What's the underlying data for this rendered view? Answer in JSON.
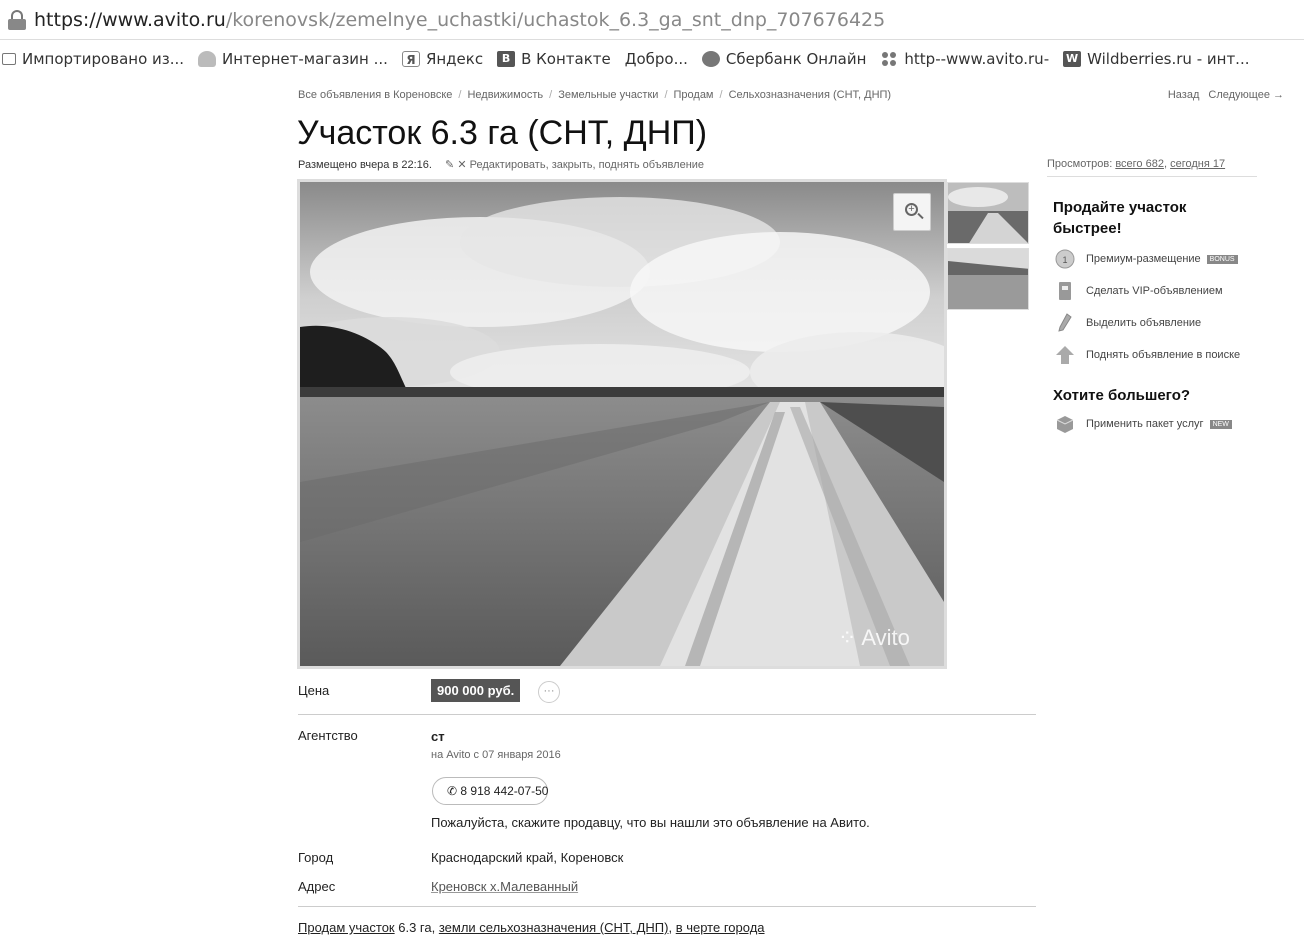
{
  "browser": {
    "url_host": "https://www.avito.ru",
    "url_path": "/korenovsk/zemelnye_uchastki/uchastok_6.3_ga_snt_dnp_707676425",
    "bookmarks": [
      {
        "label": "Импортировано из...",
        "icon": "folder-icon"
      },
      {
        "label": "Интернет-магазин ...",
        "icon": "shop-icon"
      },
      {
        "label": "Яндекс",
        "icon": "yandex-icon",
        "glyph": "Я"
      },
      {
        "label": "В Контакте",
        "icon": "vk-icon",
        "glyph": "B"
      },
      {
        "label": "Добро...",
        "icon": null
      },
      {
        "label": "Сбербанк Онлайн",
        "icon": "sberbank-icon"
      },
      {
        "label": "http--www.avito.ru-",
        "icon": "avito-icon"
      },
      {
        "label": "Wildberries.ru - инт...",
        "icon": "wildberries-icon",
        "glyph": "W"
      }
    ]
  },
  "breadcrumbs": [
    "Все объявления в Кореновске",
    "Недвижимость",
    "Земельные участки",
    "Продам",
    "Сельхозназначения (СНТ, ДНП)"
  ],
  "nav": {
    "back": "Назад",
    "next": "Следующее →"
  },
  "listing": {
    "title": "Участок 6.3 га (СНТ, ДНП)",
    "posted": "Размещено вчера в 22:16.",
    "edit_link": "Редактировать, закрыть, поднять объявление",
    "views_prefix": "Просмотров: ",
    "views_total": "всего 682",
    "views_today": "сегодня 17",
    "watermark": "Avito"
  },
  "sidebar": {
    "heading": "Продайте участок быстрее!",
    "items": [
      {
        "label": "Премиум-размещение",
        "badge": "BONUS"
      },
      {
        "label": "Сделать VIP-объявлением",
        "badge": ""
      },
      {
        "label": "Выделить объявление",
        "badge": ""
      },
      {
        "label": "Поднять объявление в поиске",
        "badge": ""
      }
    ],
    "heading2": "Хотите большего?",
    "package": {
      "label": "Применить пакет услуг",
      "badge": "NEW"
    }
  },
  "details": {
    "price_label": "Цена",
    "price": "900 000 руб.",
    "more": "···",
    "agency_label": "Агентство",
    "agency_name": "ст",
    "agency_since": "на Avito с 07 января 2016",
    "phone": "8 918 442-07-50",
    "notice": "Пожалуйста, скажите продавцу, что вы нашли это объявление на Авито.",
    "city_label": "Город",
    "city": "Краснодарский край, Кореновск",
    "address_label": "Адрес",
    "address": "Креновск х.Малеванный"
  },
  "description": {
    "part1": "Продам участок",
    "part2": " 6.3 га, ",
    "part3": "земли сельхозназначения (СНТ, ДНП)",
    "part4": ", ",
    "part5": "в черте города"
  }
}
